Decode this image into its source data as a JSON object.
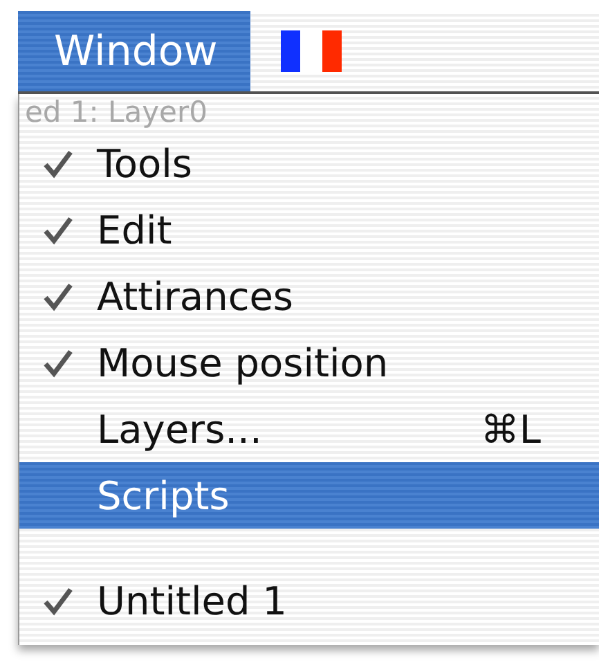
{
  "menubar": {
    "menu": {
      "title": "Window",
      "selected": true
    }
  },
  "background_text": "ed 1: Layer0",
  "menu_items": [
    {
      "kind": "item",
      "label": "Tools",
      "checked": true,
      "selected": false
    },
    {
      "kind": "item",
      "label": "Edit",
      "checked": true,
      "selected": false
    },
    {
      "kind": "item",
      "label": "Attirances",
      "checked": true,
      "selected": false
    },
    {
      "kind": "item",
      "label": "Mouse position",
      "checked": true,
      "selected": false
    },
    {
      "kind": "item",
      "label": "Layers...",
      "checked": false,
      "selected": false,
      "shortcut": "⌘L"
    },
    {
      "kind": "item",
      "label": "Scripts",
      "checked": false,
      "selected": true
    },
    {
      "kind": "separator"
    },
    {
      "kind": "item",
      "label": "Untitled 1",
      "checked": true,
      "selected": false
    }
  ]
}
